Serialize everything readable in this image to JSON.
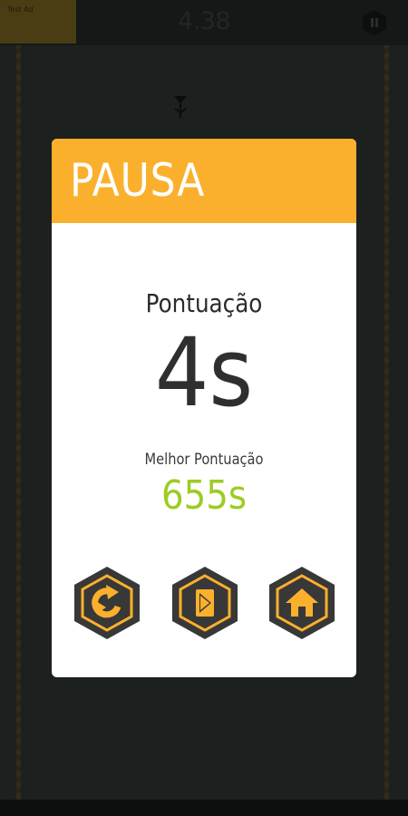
{
  "hud": {
    "timer": "4.38",
    "ad_text": "Test Ad",
    "pause_icon": "pause-icon"
  },
  "dialog": {
    "title": "PAUSA",
    "score_label": "Pontuação",
    "score_value": "4s",
    "best_label": "Melhor Pontuação",
    "best_value": "655s",
    "buttons": [
      {
        "name": "restart",
        "icon": "restart-icon"
      },
      {
        "name": "play",
        "icon": "play-icon"
      },
      {
        "name": "home",
        "icon": "home-icon"
      }
    ]
  },
  "colors": {
    "accent": "#fbb02d",
    "dark": "#383838",
    "best_score": "#9ccc23",
    "background": "#1c201f"
  }
}
